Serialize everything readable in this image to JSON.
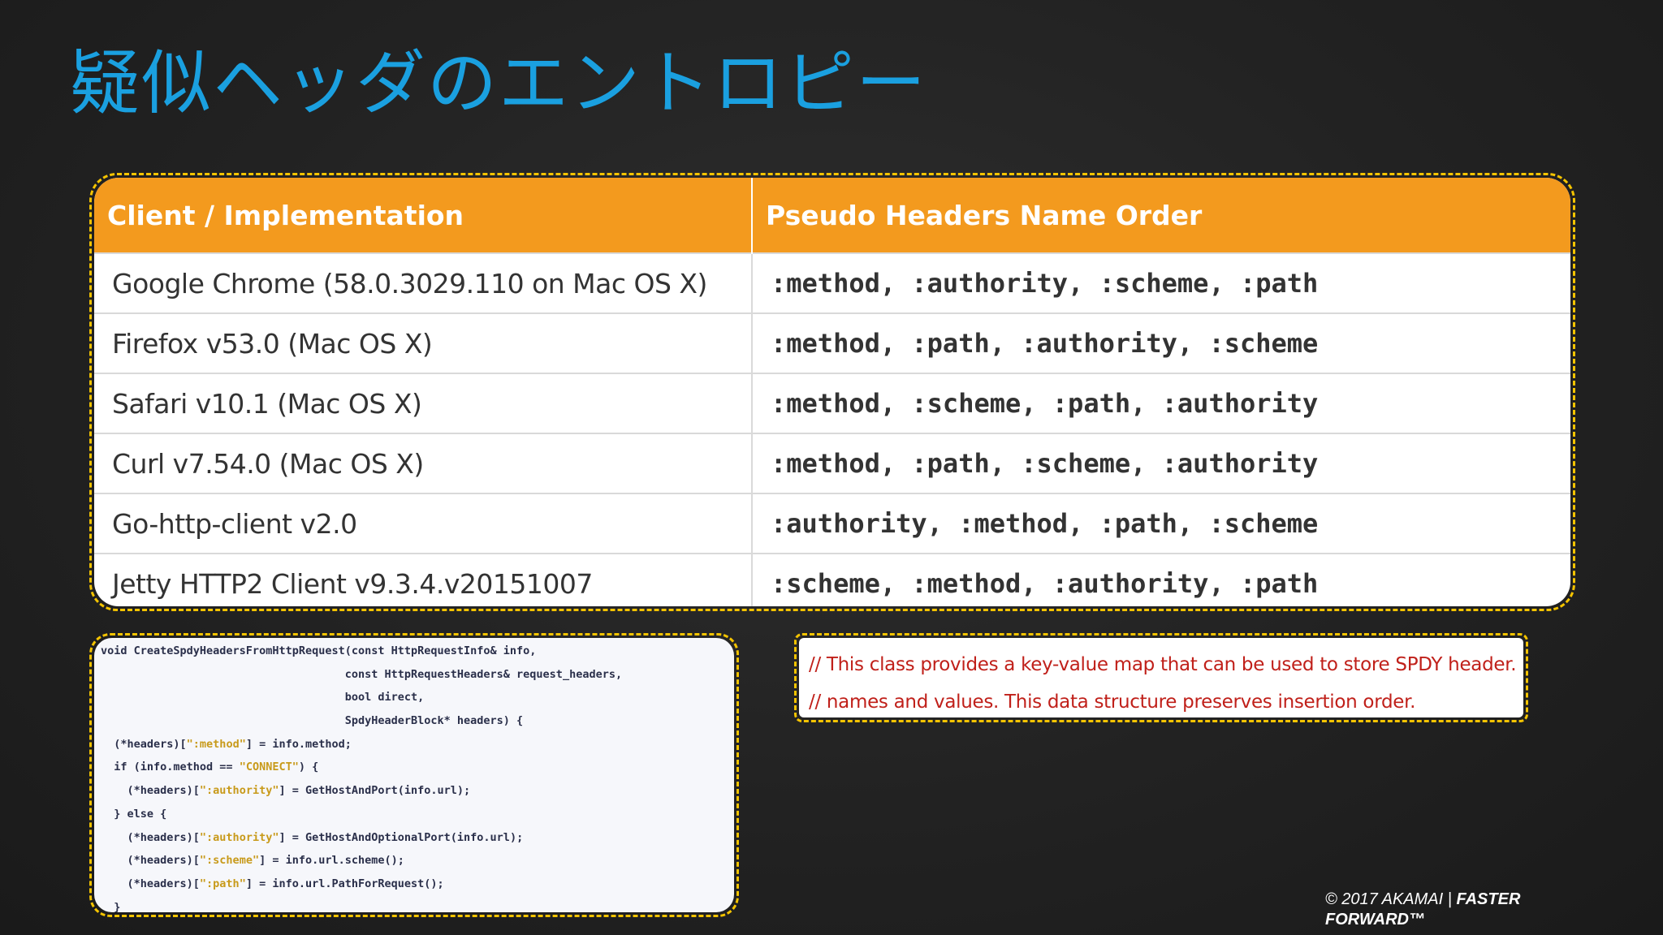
{
  "slide": {
    "title": "疑似ヘッダのエントロピー"
  },
  "table": {
    "headers": [
      "Client / Implementation",
      "Pseudo Headers Name Order"
    ],
    "rows": [
      {
        "client": "Google Chrome (58.0.3029.110 on Mac OS X)",
        "order": ":method, :authority, :scheme, :path"
      },
      {
        "client": "Firefox v53.0 (Mac OS X)",
        "order": ":method, :path, :authority, :scheme"
      },
      {
        "client": "Safari v10.1 (Mac OS X)",
        "order": ":method, :scheme, :path, :authority"
      },
      {
        "client": "Curl v7.54.0 (Mac OS X)",
        "order": ":method, :path, :scheme, :authority"
      },
      {
        "client": "Go-http-client v2.0",
        "order": ":authority, :method, :path, :scheme"
      },
      {
        "client": "Jetty HTTP2 Client v9.3.4.v20151007",
        "order": ":scheme, :method, :authority, :path"
      }
    ]
  },
  "code": {
    "lines": [
      "void CreateSpdyHeadersFromHttpRequest(const HttpRequestInfo& info,",
      "                                     const HttpRequestHeaders& request_headers,",
      "                                     bool direct,",
      "                                     SpdyHeaderBlock* headers) {",
      "  (*headers)[\":method\"] = info.method;",
      "  if (info.method == \"CONNECT\") {",
      "    (*headers)[\":authority\"] = GetHostAndPort(info.url);",
      "  } else {",
      "    (*headers)[\":authority\"] = GetHostAndOptionalPort(info.url);",
      "    (*headers)[\":scheme\"] = info.url.scheme();",
      "    (*headers)[\":path\"] = info.url.PathForRequest();",
      "  }"
    ]
  },
  "comment": {
    "lines": [
      "// This class provides a key-value map that can be used to store SPDY header.",
      "// names and values. This data structure preserves insertion order."
    ]
  },
  "footer": {
    "copyright": "© 2017 AKAMAI | ",
    "tagline_1": "FASTER",
    "tagline_2": "FORWARD™"
  },
  "colors": {
    "title": "#1aa0e0",
    "header_bg": "#f39a1e",
    "dashed_border": "#f5c400",
    "comment_text": "#c0201a"
  }
}
